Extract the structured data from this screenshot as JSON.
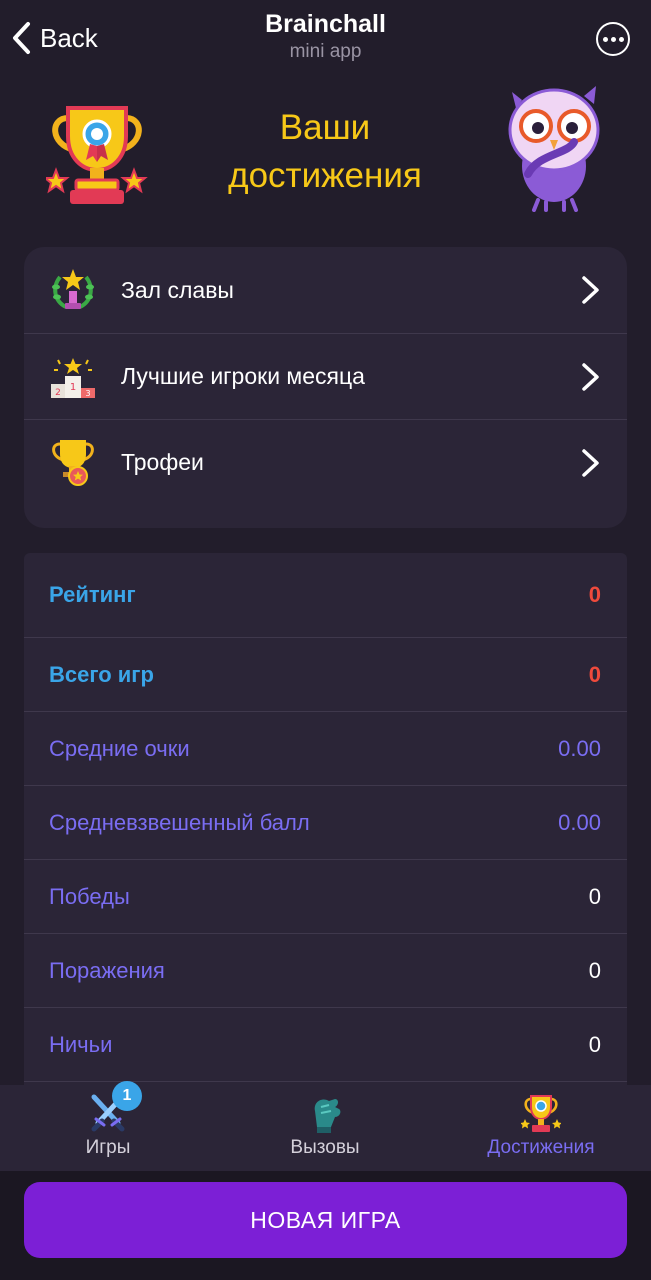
{
  "header": {
    "back_label": "Back",
    "title": "Brainchall",
    "subtitle": "mini app",
    "back_icon": "chevron-left-icon",
    "more_icon": "more-dots-icon"
  },
  "hero": {
    "title_line1": "Ваши",
    "title_line2": "достижения",
    "left_image": "trophy-icon",
    "right_image": "owl-mascot"
  },
  "menu": {
    "items": [
      {
        "label": "Зал славы",
        "icon": "laurel-trophy-icon"
      },
      {
        "label": "Лучшие игроки месяца",
        "icon": "podium-icon"
      },
      {
        "label": "Трофеи",
        "icon": "cup-medal-icon"
      }
    ]
  },
  "stats": {
    "rows": [
      {
        "label": "Рейтинг",
        "value": "0"
      },
      {
        "label": "Всего игр",
        "value": "0"
      },
      {
        "label": "Средние очки",
        "value": "0.00"
      },
      {
        "label": "Средневзвешенный балл",
        "value": "0.00"
      },
      {
        "label": "Победы",
        "value": "0"
      },
      {
        "label": "Поражения",
        "value": "0"
      },
      {
        "label": "Ничьи",
        "value": "0"
      }
    ]
  },
  "nav": {
    "games": {
      "label": "Игры",
      "badge": "1",
      "icon": "crossed-swords-icon"
    },
    "calls": {
      "label": "Вызовы",
      "icon": "glove-icon"
    },
    "achievements": {
      "label": "Достижения",
      "icon": "trophy-icon"
    }
  },
  "footer": {
    "new_game_label": "НОВАЯ ИГРА"
  },
  "colors": {
    "background": "#221d2b",
    "card": "#2b2537",
    "accent_yellow": "#f7c818",
    "accent_blue": "#3aa5e8",
    "accent_red": "#ef4a3c",
    "accent_purple": "#7a6df2",
    "button_purple": "#7c1fd6"
  }
}
